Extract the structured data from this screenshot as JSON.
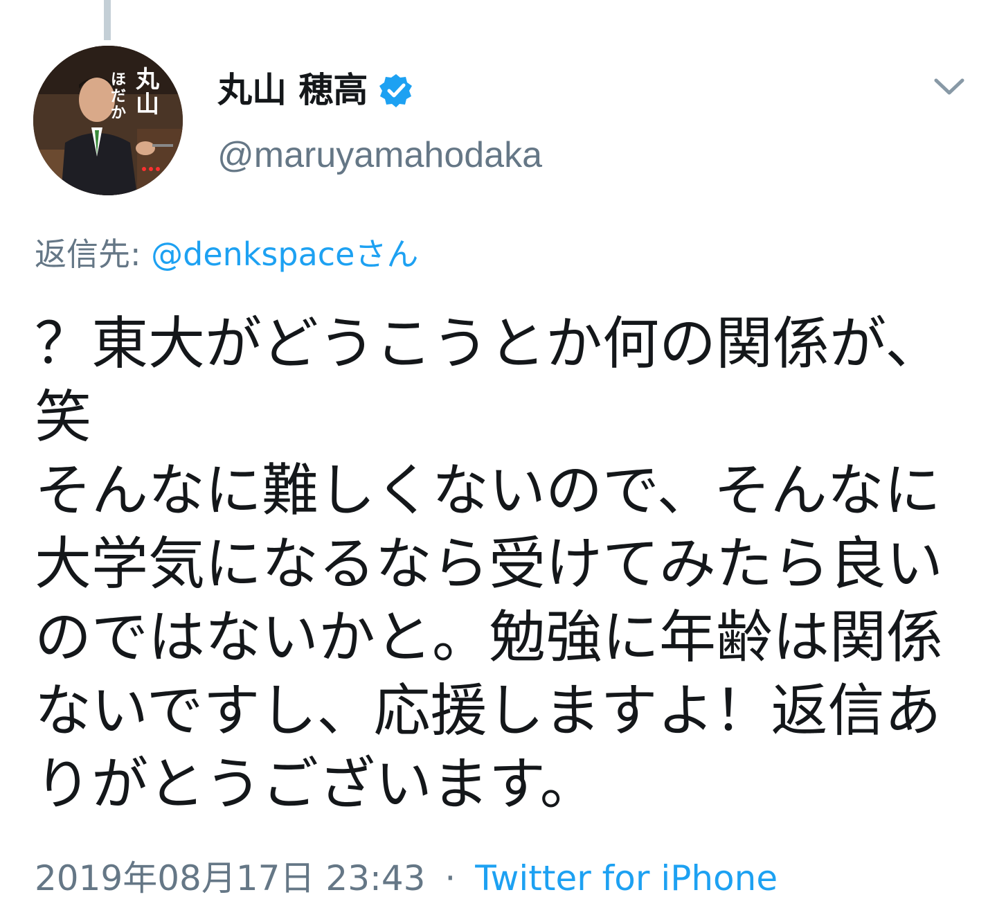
{
  "tweet": {
    "author": {
      "display_name": "丸山 穂高",
      "handle": "@maruyamahodaka",
      "verified": true,
      "avatar_text": [
        "丸山",
        "ほだか"
      ]
    },
    "reply_to": {
      "label": "返信先:",
      "user": "@denkspaceさん"
    },
    "text": "？東大がどうこうとか何の関係が、笑\nそんなに難しくないので、そんなに大学気になるなら受けてみたら良いのではないかと。勉強に年齢は関係ないですし、応援しますよ！返信ありがとうございます。",
    "timestamp": "2019年08月17日 23:43",
    "separator": "·",
    "source": "Twitter for iPhone"
  },
  "icons": {
    "verified": "verified-badge-icon",
    "menu": "chevron-down-icon"
  },
  "colors": {
    "link": "#1da1f2",
    "secondary_text": "#657786",
    "primary_text": "#14171a",
    "thread_line": "#c4cfd6"
  }
}
